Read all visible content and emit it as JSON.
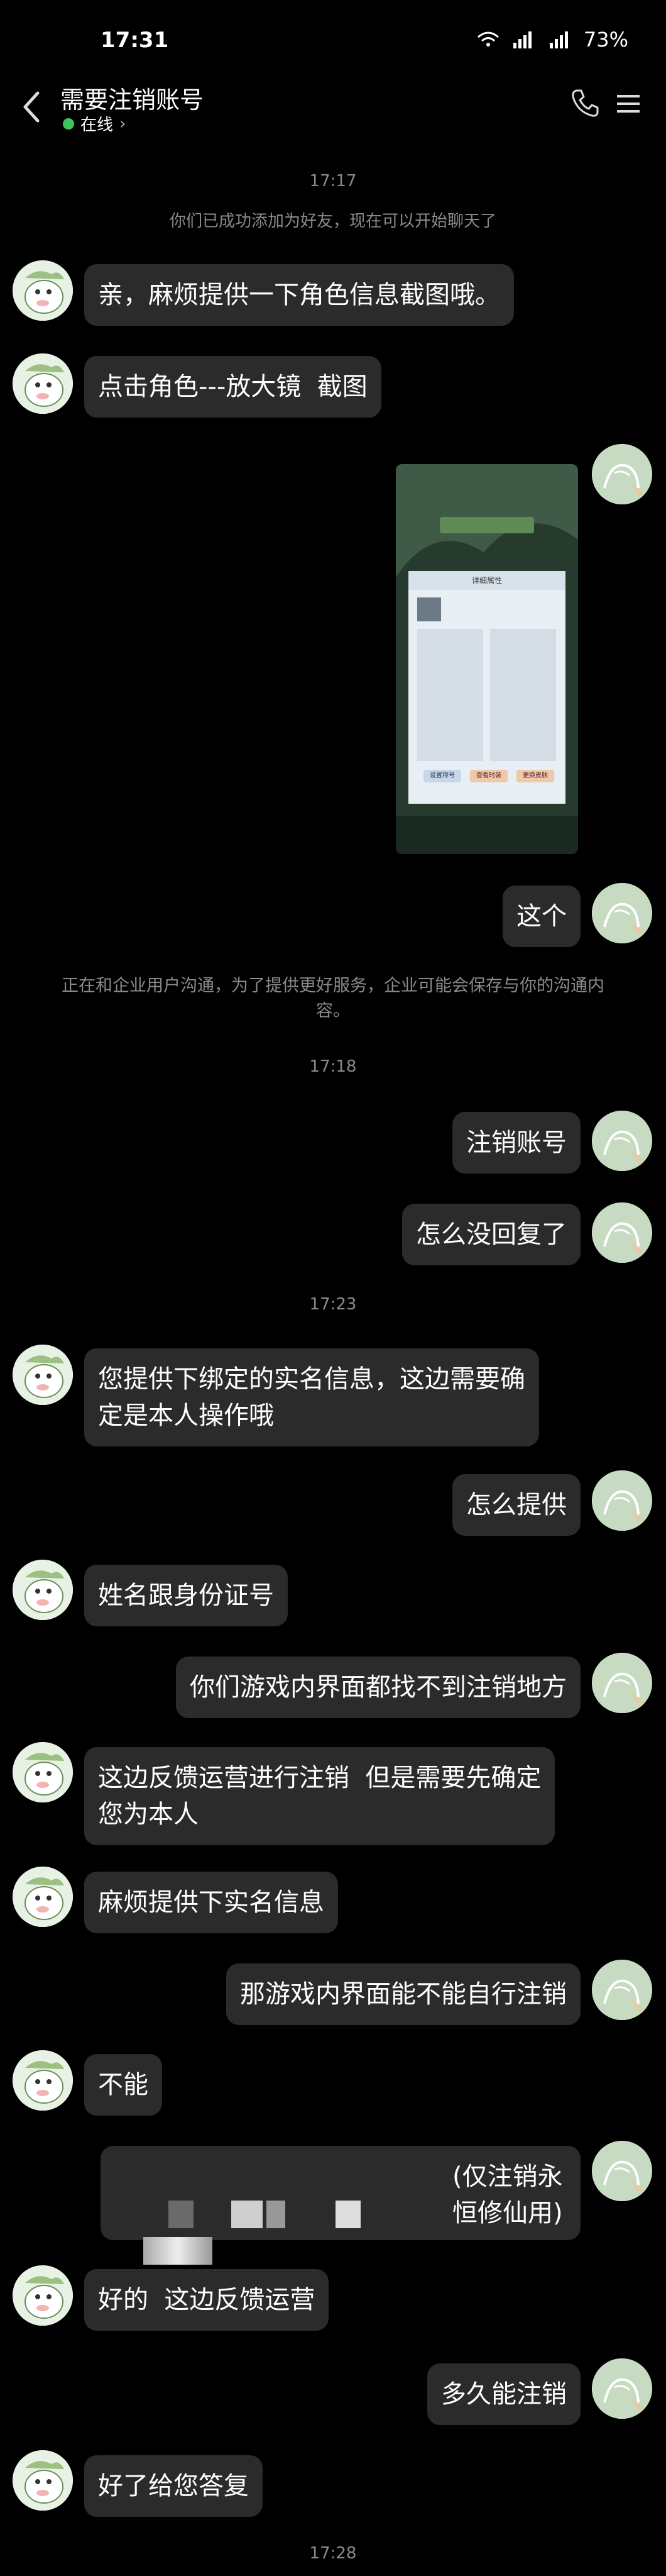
{
  "status": {
    "time": "17:31",
    "battery": "73%"
  },
  "header": {
    "title": "需要注销账号",
    "online": "在线"
  },
  "system": {
    "t1": "17:17",
    "friend_added": "你们已成功添加为好友，现在可以开始聊天了",
    "notice": "正在和企业用户沟通，为了提供更好服务，企业可能会保存与你的沟通内\n容。",
    "t2": "17:18",
    "t3": "17:23",
    "t4": "17:28"
  },
  "messages": [
    {
      "side": "left",
      "text": "亲，麻烦提供一下角色信息截图哦。"
    },
    {
      "side": "left",
      "text": "点击角色---放大镜  截图"
    },
    {
      "side": "right",
      "text": "这个"
    },
    {
      "side": "right",
      "text": "注销账号"
    },
    {
      "side": "right",
      "text": "怎么没回复了"
    },
    {
      "side": "left",
      "text": "您提供下绑定的实名信息，这边需要确\n定是本人操作哦"
    },
    {
      "side": "right",
      "text": "怎么提供"
    },
    {
      "side": "left",
      "text": "姓名跟身份证号"
    },
    {
      "side": "right",
      "text": "你们游戏内界面都找不到注销地方"
    },
    {
      "side": "left",
      "text": "这边反馈运营进行注销  但是需要先确定\n您为本人"
    },
    {
      "side": "left",
      "text": "麻烦提供下实名信息"
    },
    {
      "side": "right",
      "text": "那游戏内界面能不能自行注销"
    },
    {
      "side": "left",
      "text": "不能"
    },
    {
      "side": "right",
      "text": "(仅注销永\n恒修仙用)"
    },
    {
      "side": "left",
      "text": "好的  这边反馈运营"
    },
    {
      "side": "right",
      "text": "多久能注销"
    },
    {
      "side": "left",
      "text": "好了给您答复"
    }
  ],
  "thumbnail": {
    "panel_title": "详细属性",
    "btn1": "设置称号",
    "btn2": "查看时装",
    "btn3": "更换皮肤"
  },
  "icons": [
    "back-icon",
    "phone-icon",
    "menu-icon",
    "avatar-icon"
  ]
}
